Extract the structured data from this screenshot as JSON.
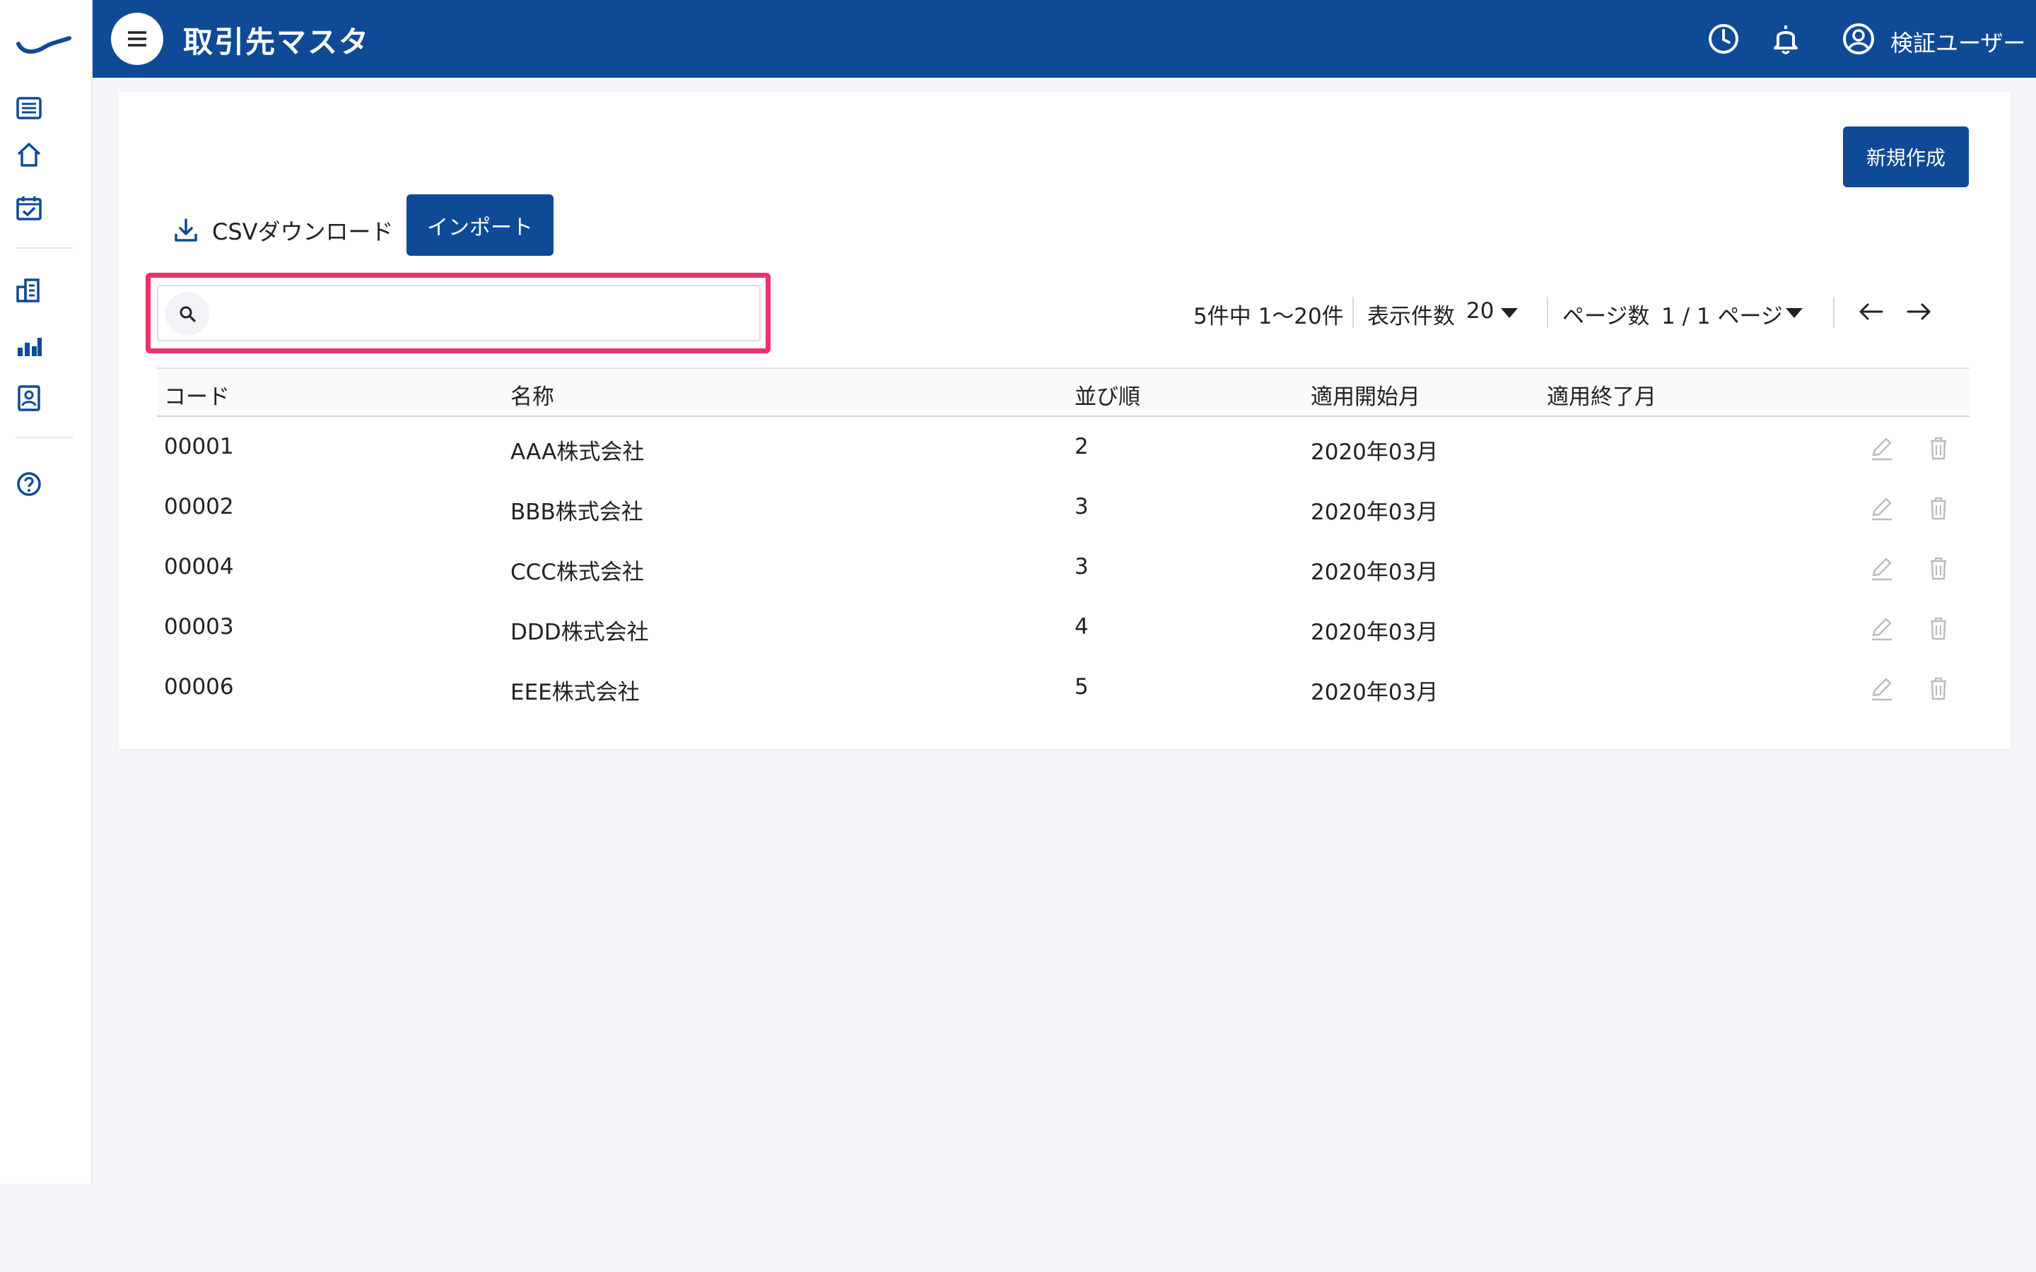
{
  "header": {
    "title": "取引先マスタ",
    "user_name": "検証ユーザー",
    "bg_color": "#0f4a97"
  },
  "sidebar": {
    "items": [
      {
        "icon": "list-icon"
      },
      {
        "icon": "home-icon"
      },
      {
        "icon": "calendar-check-icon"
      },
      {
        "icon": "building-icon"
      },
      {
        "icon": "bar-chart-icon"
      },
      {
        "icon": "contact-card-icon"
      },
      {
        "icon": "help-icon"
      }
    ]
  },
  "toolbar": {
    "new_label": "新規作成",
    "csv_download_label": "CSVダウンロード",
    "import_label": "インポート"
  },
  "search": {
    "value": "",
    "placeholder": "",
    "highlight_color": "#f0306a"
  },
  "pagination": {
    "range_text": "5件中 1〜20件",
    "per_page_label": "表示件数",
    "per_page_value": "20",
    "page_label": "ページ数",
    "page_value": "1 / 1 ページ",
    "prev": "←",
    "next": "→"
  },
  "table": {
    "columns": [
      "コード",
      "名称",
      "並び順",
      "適用開始月",
      "適用終了月"
    ],
    "rows": [
      {
        "code": "00001",
        "name": "AAA株式会社",
        "order": "2",
        "start": "2020年03月",
        "end": ""
      },
      {
        "code": "00002",
        "name": "BBB株式会社",
        "order": "3",
        "start": "2020年03月",
        "end": ""
      },
      {
        "code": "00004",
        "name": "CCC株式会社",
        "order": "3",
        "start": "2020年03月",
        "end": ""
      },
      {
        "code": "00003",
        "name": "DDD株式会社",
        "order": "4",
        "start": "2020年03月",
        "end": ""
      },
      {
        "code": "00006",
        "name": "EEE株式会社",
        "order": "5",
        "start": "2020年03月",
        "end": ""
      }
    ]
  }
}
